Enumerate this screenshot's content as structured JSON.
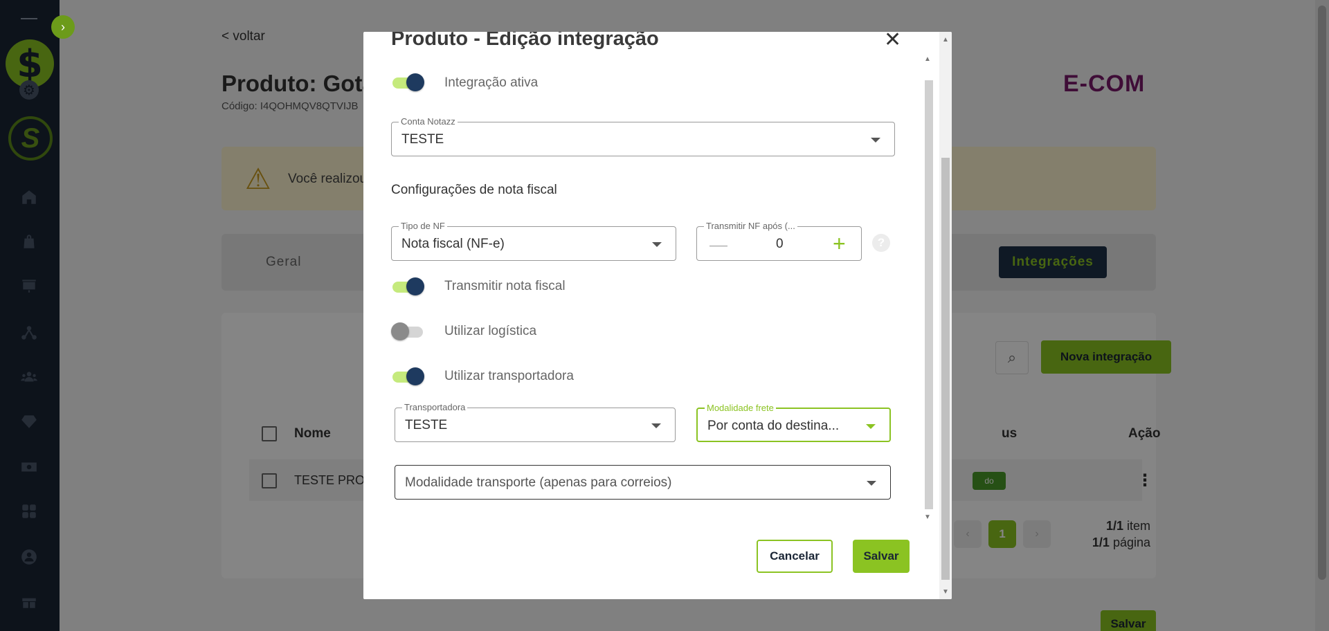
{
  "sidebar": {
    "logo_glyph": "$",
    "toggle_glyph": "›",
    "brand_glyph": "S",
    "items": [
      {
        "name": "home-icon"
      },
      {
        "name": "bag-icon"
      },
      {
        "name": "presentation-icon"
      },
      {
        "name": "network-icon"
      },
      {
        "name": "users-icon"
      },
      {
        "name": "diamond-icon"
      },
      {
        "name": "dollar-icon"
      },
      {
        "name": "apps-icon"
      },
      {
        "name": "account-icon"
      },
      {
        "name": "gift-icon"
      }
    ]
  },
  "page": {
    "back_label": "< voltar",
    "product_title": "Produto: Gota",
    "product_code": "Código: I4QOHMQV8QTVIJB",
    "brand_logo": "E-COM",
    "warning_text": "Você realizou",
    "tab_general": "Geral",
    "tab_integrations": "Integrações",
    "new_integration_label": "Nova integração",
    "table": {
      "col_name": "Nome",
      "col_status": "us",
      "col_action": "Ação",
      "rows": [
        {
          "name": "TESTE PROD",
          "status": "do"
        }
      ]
    },
    "pagination": {
      "current_page": "1",
      "items_count": "1/1",
      "items_label": "item",
      "pages_count": "1/1",
      "pages_label": "página"
    },
    "save_label": "Salvar"
  },
  "modal": {
    "title": "Produto - Edição integração",
    "close_glyph": "✕",
    "toggle_integration_label": "Integração ativa",
    "toggle_integration_on": true,
    "account_legend": "Conta Notazz",
    "account_value": "TESTE",
    "section_title": "Configurações de nota fiscal",
    "nf_type_legend": "Tipo de NF",
    "nf_type_value": "Nota fiscal (NF-e)",
    "transmit_after_legend": "Transmitir NF após (...",
    "transmit_after_value": "0",
    "minus_glyph": "—",
    "plus_glyph": "+",
    "help_glyph": "?",
    "toggle_transmit_label": "Transmitir nota fiscal",
    "toggle_transmit_on": true,
    "toggle_logistics_label": "Utilizar logística",
    "toggle_logistics_on": false,
    "toggle_carrier_label": "Utilizar transportadora",
    "toggle_carrier_on": true,
    "carrier_legend": "Transportadora",
    "carrier_value": "TESTE",
    "freight_legend": "Modalidade frete",
    "freight_value": "Por conta do destina...",
    "transport_placeholder": "Modalidade transporte (apenas para correios)",
    "cancel_label": "Cancelar",
    "save_label": "Salvar"
  },
  "colors": {
    "accent": "#8bc322",
    "sidebar_bg": "#1a2535",
    "toggle_knob": "#1e3a5f",
    "toggle_track_on": "#c5ea7d",
    "tab_active_bg": "#1e3148"
  }
}
